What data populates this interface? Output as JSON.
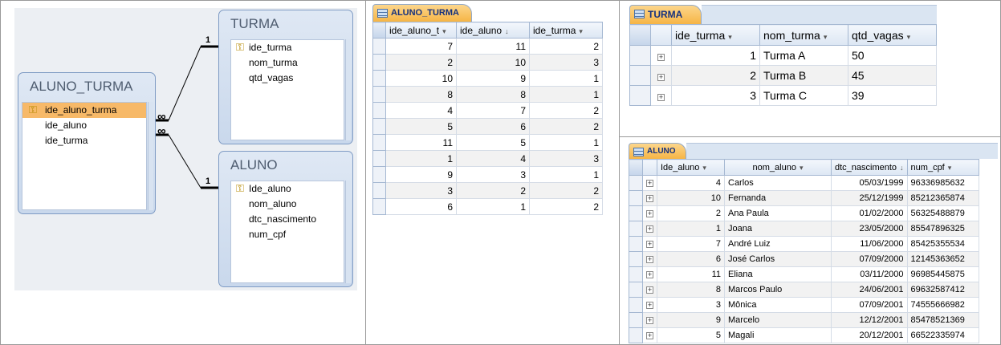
{
  "diagram": {
    "aluno_turma": {
      "title": "ALUNO_TURMA",
      "fields": [
        "ide_aluno_turma",
        "ide_aluno",
        "ide_turma"
      ]
    },
    "turma": {
      "title": "TURMA",
      "fields": [
        "ide_turma",
        "nom_turma",
        "qtd_vagas"
      ]
    },
    "aluno": {
      "title": "ALUNO",
      "fields": [
        "Ide_aluno",
        "nom_aluno",
        "dtc_nascimento",
        "num_cpf"
      ]
    },
    "cardinality": {
      "one": "1",
      "many": "∞"
    }
  },
  "aluno_turma_sheet": {
    "tab": "ALUNO_TURMA",
    "columns": [
      "ide_aluno_t",
      "ide_aluno",
      "ide_turma"
    ],
    "column_arrows": [
      "▾",
      "↓",
      "▾"
    ],
    "rows": [
      [
        "7",
        "11",
        "2"
      ],
      [
        "2",
        "10",
        "3"
      ],
      [
        "10",
        "9",
        "1"
      ],
      [
        "8",
        "8",
        "1"
      ],
      [
        "4",
        "7",
        "2"
      ],
      [
        "5",
        "6",
        "2"
      ],
      [
        "11",
        "5",
        "1"
      ],
      [
        "1",
        "4",
        "3"
      ],
      [
        "9",
        "3",
        "1"
      ],
      [
        "3",
        "2",
        "2"
      ],
      [
        "6",
        "1",
        "2"
      ]
    ]
  },
  "turma_sheet": {
    "tab": "TURMA",
    "columns": [
      "ide_turma",
      "nom_turma",
      "qtd_vagas"
    ],
    "rows": [
      [
        "1",
        "Turma A",
        "50"
      ],
      [
        "2",
        "Turma B",
        "45"
      ],
      [
        "3",
        "Turma C",
        "39"
      ]
    ]
  },
  "aluno_sheet": {
    "tab": "ALUNO",
    "columns": [
      "Ide_aluno",
      "nom_aluno",
      "dtc_nascimento",
      "num_cpf"
    ],
    "column_arrows": [
      "▾",
      "▾",
      "↓",
      "▾"
    ],
    "rows": [
      [
        "4",
        "Carlos",
        "05/03/1999",
        "96336985632"
      ],
      [
        "10",
        "Fernanda",
        "25/12/1999",
        "85212365874"
      ],
      [
        "2",
        "Ana Paula",
        "01/02/2000",
        "56325488879"
      ],
      [
        "1",
        "Joana",
        "23/05/2000",
        "85547896325"
      ],
      [
        "7",
        "André Luiz",
        "11/06/2000",
        "85425355534"
      ],
      [
        "6",
        "José Carlos",
        "07/09/2000",
        "12145363652"
      ],
      [
        "11",
        "Eliana",
        "03/11/2000",
        "96985445875"
      ],
      [
        "8",
        "Marcos Paulo",
        "24/06/2001",
        "69632587412"
      ],
      [
        "3",
        "Mônica",
        "07/09/2001",
        "74555666982"
      ],
      [
        "9",
        "Marcelo",
        "12/12/2001",
        "85478521369"
      ],
      [
        "5",
        "Magali",
        "20/12/2001",
        "66522335974"
      ]
    ]
  }
}
